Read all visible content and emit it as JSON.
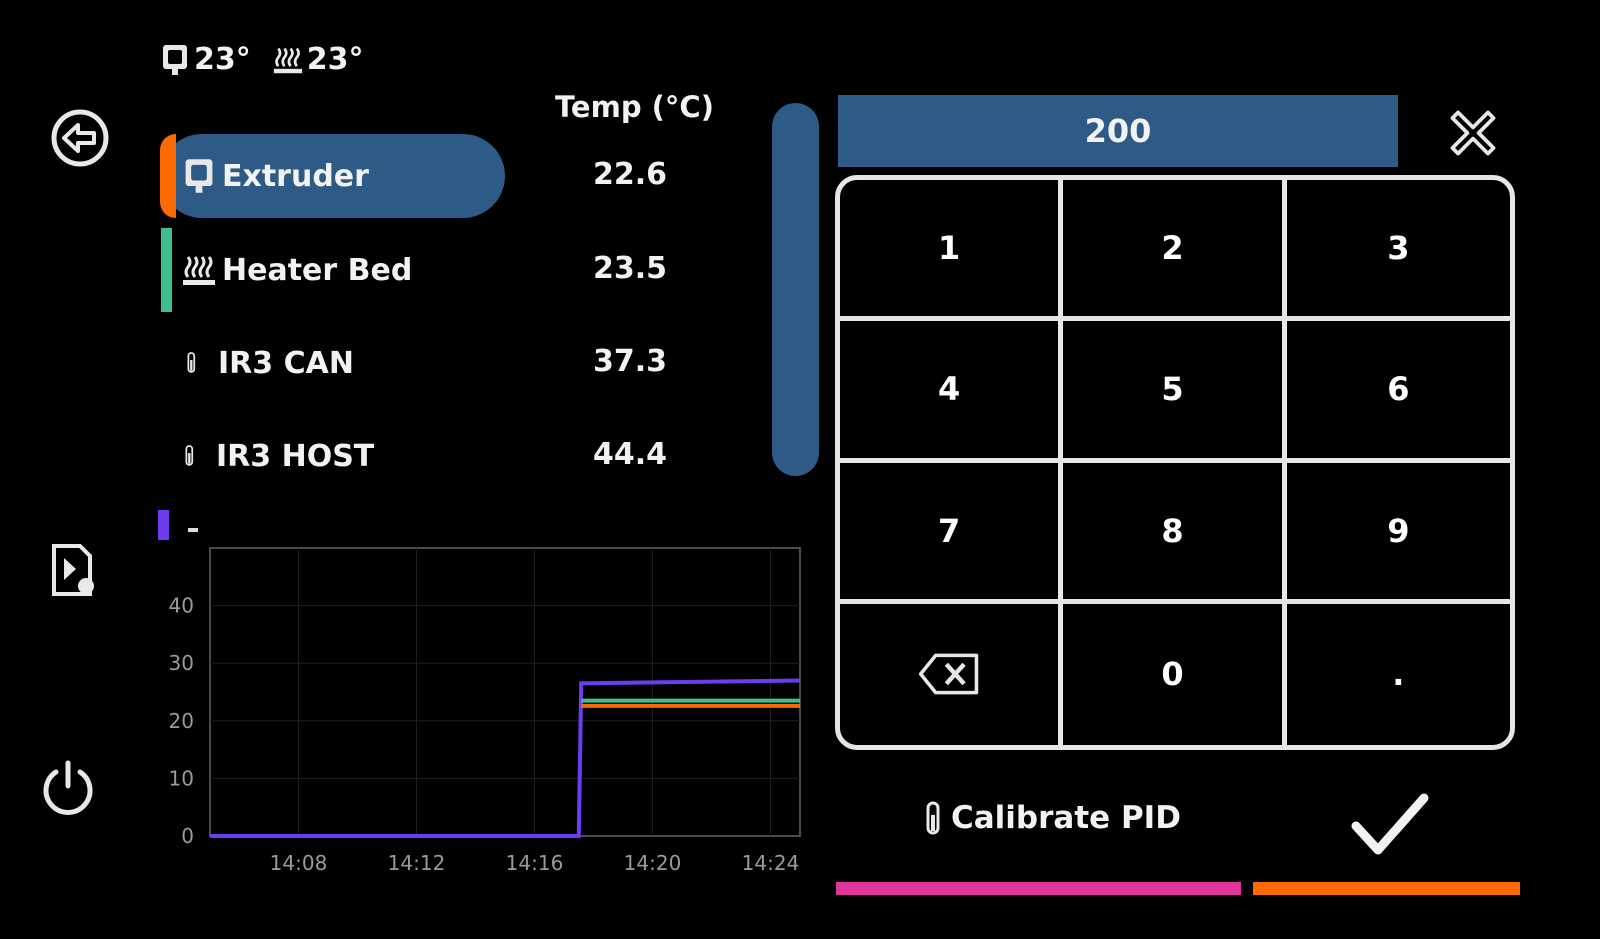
{
  "status": {
    "extruder_temp": "23°",
    "bed_temp": "23°"
  },
  "header": {
    "temp_label": "Temp (°C)"
  },
  "sensors": [
    {
      "name": "Extruder",
      "value": "22.6",
      "icon": "extruder-icon",
      "color": "#ff6a00",
      "selected": true
    },
    {
      "name": "Heater Bed",
      "value": "23.5",
      "icon": "heater-bed-icon",
      "color": "#3fbf8f",
      "selected": false
    },
    {
      "name": "IR3 CAN",
      "value": "37.3",
      "icon": "thermometer-icon",
      "selected": false
    },
    {
      "name": "IR3 HOST",
      "value": "44.4",
      "icon": "thermometer-icon",
      "selected": false
    }
  ],
  "legend": {
    "color": "#6f3bf0",
    "label": "-"
  },
  "keypad": {
    "display_value": "200",
    "keys": [
      "1",
      "2",
      "3",
      "4",
      "5",
      "6",
      "7",
      "8",
      "9",
      "backspace",
      "0",
      "."
    ]
  },
  "calibrate_label": "Calibrate PID",
  "colors": {
    "accent": "#2e5a86",
    "magenta": "#e0369c",
    "orange": "#ff6a00",
    "purple": "#6f3bf0",
    "teal": "#3fbf8f"
  },
  "chart_data": {
    "type": "line",
    "title": "",
    "xlabel": "",
    "ylabel": "",
    "x_ticks": [
      "14:08",
      "14:12",
      "14:16",
      "14:20",
      "14:24"
    ],
    "y_ticks": [
      0,
      10,
      20,
      30,
      40
    ],
    "ylim": [
      0,
      50
    ],
    "xlim": [
      "14:05",
      "14:25"
    ],
    "grid": true,
    "series": [
      {
        "color": "#6f3bf0",
        "x": [
          "14:05",
          "14:17:30",
          "14:17:35",
          "14:25"
        ],
        "y": [
          0,
          0,
          26.5,
          27.0
        ]
      },
      {
        "color": "#3fbf8f",
        "x": [
          "14:17:35",
          "14:25"
        ],
        "y": [
          23.5,
          23.5
        ]
      },
      {
        "color": "#ff6a00",
        "x": [
          "14:17:35",
          "14:25"
        ],
        "y": [
          22.6,
          22.6
        ]
      }
    ]
  }
}
